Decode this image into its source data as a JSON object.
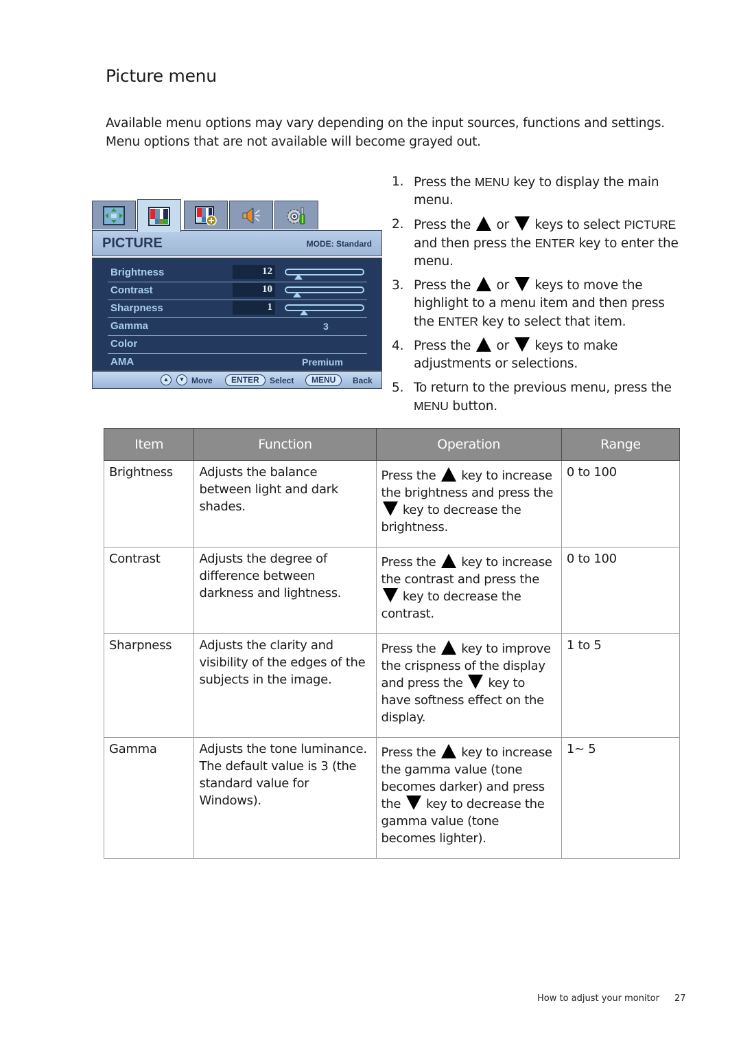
{
  "page": {
    "title": "Picture menu",
    "intro": "Available menu options may vary depending on the input sources, functions and settings. Menu options that are not available will become grayed out."
  },
  "osd": {
    "tabs": [
      {
        "icon": "display-position-icon",
        "active": false
      },
      {
        "icon": "picture-icon",
        "active": true
      },
      {
        "icon": "picture-advanced-icon",
        "active": false
      },
      {
        "icon": "audio-icon",
        "active": false
      },
      {
        "icon": "system-settings-icon",
        "active": false
      }
    ],
    "header": {
      "title": "PICTURE",
      "mode": "MODE: Standard"
    },
    "items": [
      {
        "label": "Brightness",
        "value": "12",
        "slider_fraction": 0.12
      },
      {
        "label": "Contrast",
        "value": "10",
        "slider_fraction": 0.1
      },
      {
        "label": "Sharpness",
        "value": "1",
        "slider_fraction": 0.2
      },
      {
        "label": "Gamma",
        "value": "3"
      },
      {
        "label": "Color",
        "value": ""
      },
      {
        "label": "AMA",
        "value": "Premium"
      }
    ],
    "footer": {
      "move": "Move",
      "enter_key": "ENTER",
      "select": "Select",
      "menu_key": "MENU",
      "back": "Back",
      "up_glyph": "▲",
      "down_glyph": "▼"
    }
  },
  "steps": [
    {
      "n": "1.",
      "parts": [
        "Press the ",
        "MENU",
        " key to display the main menu."
      ]
    },
    {
      "n": "2.",
      "parts": [
        "Press the ",
        "UP",
        " or ",
        "DOWN",
        " keys to select ",
        "PICTURE",
        " and then press the ",
        "ENTER",
        " key to enter the menu."
      ]
    },
    {
      "n": "3.",
      "parts": [
        "Press the ",
        "UP",
        " or ",
        "DOWN",
        " keys to move the highlight to a menu item and then press the ",
        "ENTER",
        " key to select that item."
      ]
    },
    {
      "n": "4.",
      "parts": [
        "Press the ",
        "UP",
        " or ",
        "DOWN",
        " keys to make adjustments or selections."
      ]
    },
    {
      "n": "5.",
      "parts": [
        "To return to the previous menu, press the ",
        "MENU",
        " button."
      ]
    }
  ],
  "table": {
    "headers": [
      "Item",
      "Function",
      "Operation",
      "Range"
    ],
    "rows": [
      {
        "item": "Brightness",
        "function": "Adjusts the balance between light and dark shades.",
        "op": [
          "Press the ",
          "UP",
          " key to increase the brightness and press the ",
          "DOWN",
          " key to decrease the brightness."
        ],
        "range": "0 to 100"
      },
      {
        "item": "Contrast",
        "function": "Adjusts the degree of difference between darkness and lightness.",
        "op": [
          "Press the ",
          "UP",
          " key to increase the contrast and press the ",
          "DOWN",
          " key to decrease the contrast."
        ],
        "range": "0 to 100"
      },
      {
        "item": "Sharpness",
        "function": "Adjusts the clarity and visibility of the edges of the subjects in the image.",
        "op": [
          "Press the ",
          "UP",
          " key to improve the crispness of the display and press the ",
          "DOWN",
          " key to have softness effect on the display."
        ],
        "range": "1 to 5"
      },
      {
        "item": "Gamma",
        "function": "Adjusts the tone luminance. The default value is 3 (the standard value for Windows).",
        "op": [
          "Press the ",
          "UP",
          " key to increase the gamma value (tone becomes darker) and press the ",
          "DOWN",
          " key to decrease the gamma value (tone becomes lighter)."
        ],
        "range": "1~ 5"
      }
    ]
  },
  "footer": {
    "section": "How to adjust your monitor",
    "page": "27"
  }
}
